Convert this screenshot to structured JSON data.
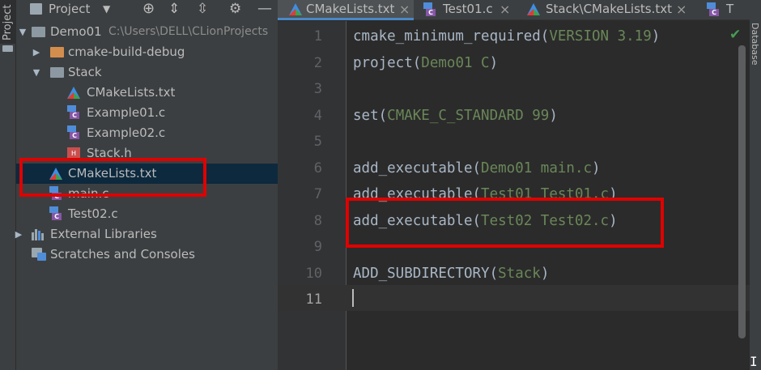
{
  "left_stripe": {
    "tab_label": "Project"
  },
  "panel_header": {
    "title": "Project",
    "dropdown_icon": "chevron-down-icon"
  },
  "tree": {
    "root": {
      "label": "Demo01",
      "path": "C:\\Users\\DELL\\CLionProjects"
    },
    "cmake_build_debug": "cmake-build-debug",
    "stack_folder": "Stack",
    "stack_cmakelists": "CMakeLists.txt",
    "stack_example01": "Example01.c",
    "stack_example02": "Example02.c",
    "stack_header": "Stack.h",
    "root_cmakelists": "CMakeLists.txt",
    "main_c": "main.c",
    "test02_c": "Test02.c",
    "external_libraries": "External Libraries",
    "scratches": "Scratches and Consoles",
    "selected": "CMakeLists.txt"
  },
  "tabs": [
    {
      "label": "CMakeLists.txt",
      "close": "×",
      "active": true
    },
    {
      "label": "Test01.c",
      "close": "×"
    },
    {
      "label": "Stack\\CMakeLists.txt",
      "close": "×"
    },
    {
      "label": "T"
    }
  ],
  "editor": {
    "current_line": 11,
    "lines": [
      {
        "no": "1",
        "fn": "cmake_minimum_required(",
        "arg": "VERSION 3.19",
        "end": ")"
      },
      {
        "no": "2",
        "fn": "project(",
        "arg": "Demo01 C",
        "end": ")"
      },
      {
        "no": "3",
        "fn": "",
        "arg": "",
        "end": ""
      },
      {
        "no": "4",
        "fn": "set(",
        "arg": "CMAKE_C_STANDARD 99",
        "end": ")"
      },
      {
        "no": "5",
        "fn": "",
        "arg": "",
        "end": ""
      },
      {
        "no": "6",
        "fn": "add_executable(",
        "arg": "Demo01 main.c",
        "end": ")"
      },
      {
        "no": "7",
        "fn": "add_executable(",
        "arg": "Test01 Test01.c",
        "end": ")"
      },
      {
        "no": "8",
        "fn": "add_executable(",
        "arg": "Test02 Test02.c",
        "end": ")"
      },
      {
        "no": "9",
        "fn": "",
        "arg": "",
        "end": ""
      },
      {
        "no": "10",
        "fn": "ADD_SUBDIRECTORY(",
        "arg": "Stack",
        "end": ")"
      },
      {
        "no": "11",
        "fn": "",
        "arg": "",
        "end": ""
      }
    ]
  },
  "right_stripe": {
    "tab_label": "Database"
  },
  "inspection": {
    "status_icon": "check-icon",
    "symbol": "✔"
  },
  "colors": {
    "annotation_red": "#e00000",
    "selection": "#0d293e",
    "keyword_arg": "#6a8759",
    "accent": "#4a88c7"
  }
}
